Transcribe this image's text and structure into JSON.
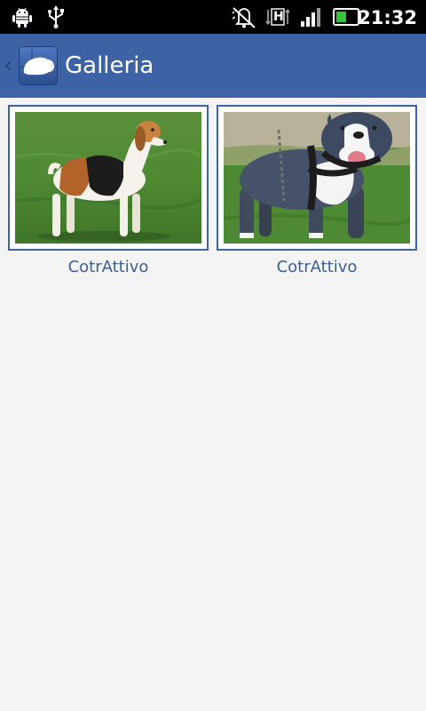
{
  "status_bar": {
    "time": "21:32",
    "icons": [
      "android-debug-icon",
      "usb-icon",
      "silent-mode-icon",
      "hspa-data-icon",
      "signal-icon",
      "battery-icon"
    ],
    "hspa_label": "H"
  },
  "action_bar": {
    "title": "Galleria",
    "back_icon": "chevron-left-icon",
    "app_icon": "dog-head-icon",
    "background_color": "#3d62a6"
  },
  "gallery": {
    "items": [
      {
        "caption": "CotrAttivo",
        "image": "beagle-dog-photo"
      },
      {
        "caption": "CotrAttivo",
        "image": "pitbull-dog-photo"
      }
    ]
  },
  "colors": {
    "accent": "#3d62a6",
    "caption_text": "#3a5f96",
    "background": "#f4f4f4"
  }
}
